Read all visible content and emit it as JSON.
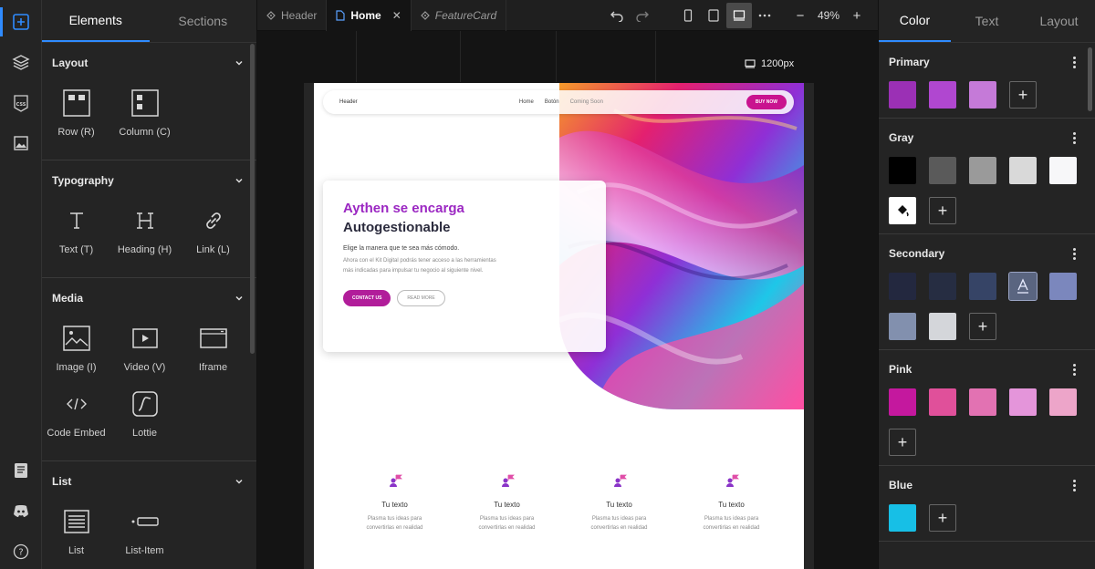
{
  "left_panel": {
    "tabs": [
      "Elements",
      "Sections"
    ],
    "sections": {
      "layout": {
        "title": "Layout",
        "items": [
          "Row (R)",
          "Column (C)"
        ]
      },
      "typography": {
        "title": "Typography",
        "items": [
          "Text (T)",
          "Heading (H)",
          "Link (L)"
        ]
      },
      "media": {
        "title": "Media",
        "items": [
          "Image (I)",
          "Video (V)",
          "Iframe",
          "Code Embed",
          "Lottie"
        ]
      },
      "list": {
        "title": "List",
        "items": [
          "List",
          "List-Item"
        ]
      }
    }
  },
  "toolbar": {
    "tabs": [
      "Header",
      "Home",
      "FeatureCard"
    ],
    "zoom": "49%",
    "zoom_minus": "−",
    "zoom_plus": "+"
  },
  "canvas": {
    "width_label": "1200px",
    "nav": {
      "brand": "Header",
      "links": [
        "Home",
        "Botón",
        "Coming Soon"
      ],
      "cta": "BUY NOW"
    },
    "hero": {
      "title1": "Aythen se encarga",
      "title2": "Autogestionable",
      "lead": "Elige la manera que te sea más cómodo.",
      "body": "Ahora con el Kit Digital podrás tener acceso a las herramientas más indicadas para impulsar tu negocio al siguiente nivel.",
      "btn_primary": "CONTACT US",
      "btn_secondary": "READ MORE"
    },
    "features": [
      {
        "title": "Tu texto",
        "desc": "Plasma tus ideas para convertirlas en realidad"
      },
      {
        "title": "Tu texto",
        "desc": "Plasma tus ideas para convertirlas en realidad"
      },
      {
        "title": "Tu texto",
        "desc": "Plasma tus ideas para convertirlas en realidad"
      },
      {
        "title": "Tu texto",
        "desc": "Plasma tus ideas para convertirlas en realidad"
      }
    ]
  },
  "right_panel": {
    "tabs": [
      "Color",
      "Text",
      "Layout"
    ],
    "groups": {
      "primary": {
        "title": "Primary",
        "colors": [
          "#9b30b5",
          "#b047d0",
          "#c57ad8"
        ]
      },
      "gray": {
        "title": "Gray",
        "colors": [
          "#000000",
          "#5a5a5a",
          "#9a9a9a",
          "#d9d9d9",
          "#f7f7f9",
          "#ffffff"
        ]
      },
      "secondary": {
        "title": "Secondary",
        "colors": [
          "#23283f",
          "#262d42",
          "#364466",
          "#5a6580",
          "#7b87bd",
          "#8290ae",
          "#d4d6da"
        ]
      },
      "pink": {
        "title": "Pink",
        "colors": [
          "#c4189e",
          "#e0509a",
          "#e272b2",
          "#e495da",
          "#eda5c9"
        ]
      },
      "blue": {
        "title": "Blue",
        "colors": [
          "#17bfe6"
        ]
      }
    }
  }
}
